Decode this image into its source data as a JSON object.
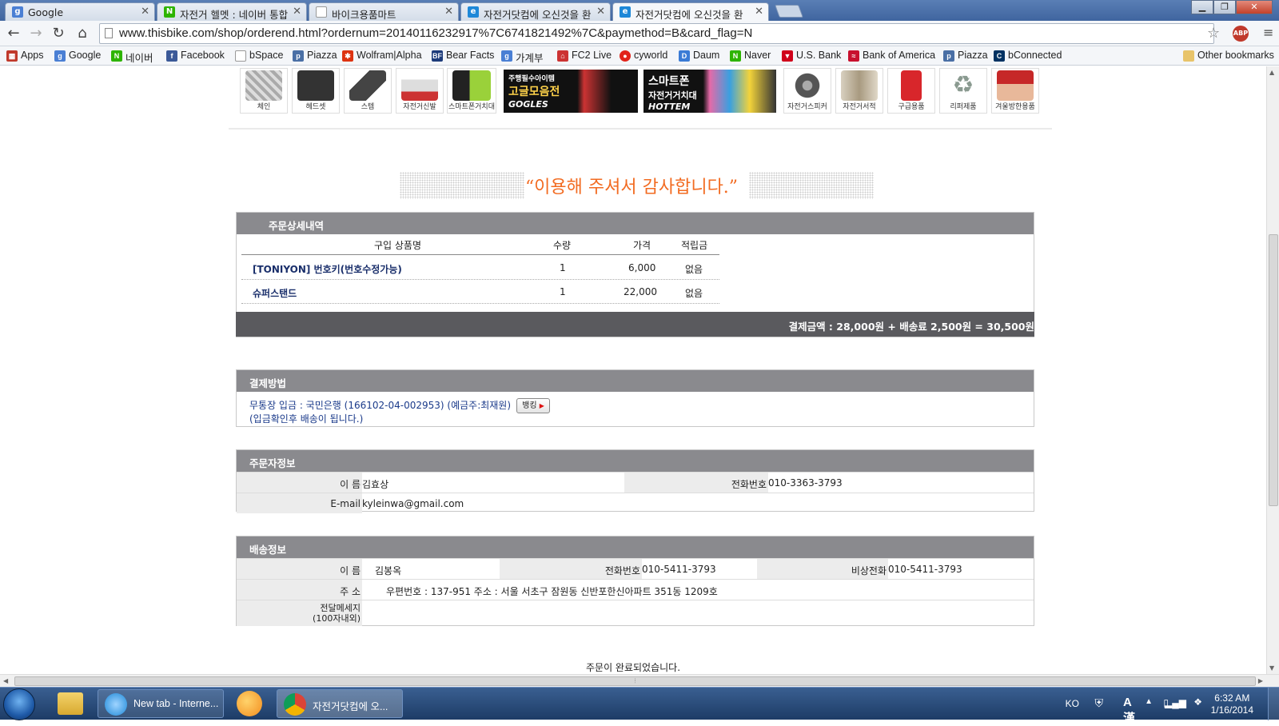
{
  "browser": {
    "tabs": [
      {
        "title": "Google",
        "icon": "google-icon",
        "color": "#4a7fd4"
      },
      {
        "title": "자전거 헬멧 : 네이버 통합",
        "icon": "naver-icon",
        "color": "#2db400"
      },
      {
        "title": "바이크용품마트",
        "icon": "page-icon",
        "color": "#999999"
      },
      {
        "title": "자전거닷컴에 오신것을 환",
        "icon": "ie-icon",
        "color": "#1e88d8"
      },
      {
        "title": "자전거닷컴에 오신것을 환",
        "icon": "ie-icon",
        "color": "#1e88d8"
      }
    ],
    "url": "www.thisbike.com/shop/orderend.html?ordernum=20140116232917%7C6741821492%7C&paymethod=B&card_flag=N",
    "abp_label": "ABP",
    "bookmarks": [
      {
        "label": "Apps",
        "color": "#c0392b"
      },
      {
        "label": "Google",
        "color": "#4a7fd4"
      },
      {
        "label": "네이버",
        "color": "#2db400"
      },
      {
        "label": "Facebook",
        "color": "#3b5998"
      },
      {
        "label": "bSpace",
        "color": "#999999"
      },
      {
        "label": "Piazza",
        "color": "#4a6fa5"
      },
      {
        "label": "Wolfram|Alpha",
        "color": "#dd3311"
      },
      {
        "label": "Bear Facts",
        "color": "#1d3b7a"
      },
      {
        "label": "가계부",
        "color": "#4a7fd4"
      },
      {
        "label": "FC2 Live",
        "color": "#cc3333"
      },
      {
        "label": "cyworld",
        "color": "#e2231a"
      },
      {
        "label": "Daum",
        "color": "#3a7bd5"
      },
      {
        "label": "Naver",
        "color": "#2db400"
      },
      {
        "label": "U.S. Bank",
        "color": "#d0021b"
      },
      {
        "label": "Bank of America",
        "color": "#c8102e"
      },
      {
        "label": "Piazza",
        "color": "#4a6fa5"
      },
      {
        "label": "bConnected",
        "color": "#003262"
      }
    ],
    "other_bookmarks": "Other bookmarks"
  },
  "categories": [
    {
      "label": "체인",
      "color": "#b8b8b8"
    },
    {
      "label": "헤드셋",
      "color": "#333333"
    },
    {
      "label": "스템",
      "color": "#444444"
    },
    {
      "label": "자전거신발",
      "color": "#d9d9d9"
    },
    {
      "label": "스마트폰거치대",
      "color": "#9ad13a"
    },
    {
      "label": "자전거스피커",
      "color": "#555555"
    },
    {
      "label": "자전거서적",
      "color": "#c8c0b0"
    },
    {
      "label": "구급용품",
      "color": "#d8262b"
    },
    {
      "label": "리퍼제품",
      "color": "#9aa5a0"
    },
    {
      "label": "겨울방한용품",
      "color": "#c62828"
    }
  ],
  "banners": [
    {
      "line1": "주행필수아이템",
      "line2": "고글모음전",
      "line3": "GOGLES",
      "color": "#222222"
    },
    {
      "line1": "스마트폰",
      "line2": "자전거거치대",
      "line3": "HOTTEM",
      "color": "#1a1a1a"
    }
  ],
  "thanks": "“이용해 주셔서 감사합니다.”",
  "order": {
    "title": "주문상세내역",
    "headers": [
      "구입 상품명",
      "수량",
      "가격",
      "적립금"
    ],
    "rows": [
      {
        "name": "[TONIYON] 번호키(번호수정가능)",
        "qty": "1",
        "price": "6,000",
        "points": "없음"
      },
      {
        "name": "슈퍼스탠드",
        "qty": "1",
        "price": "22,000",
        "points": "없음"
      }
    ],
    "total": "결제금액 : 28,000원 + 배송료 2,500원 = 30,500원"
  },
  "payment": {
    "title": "결제방법",
    "line1": "무통장 입금 : 국민은행 (166102-04-002953) (예금주:최재원)",
    "line2": "(입금확인후 배송이 됩니다.)",
    "bank_button": "뱅킹"
  },
  "orderer": {
    "title": "주문자정보",
    "name_label": "이 름",
    "name": "김효상",
    "phone_label": "전화번호",
    "phone": "010-3363-3793",
    "email_label": "E-mail",
    "email": "kyleinwa@gmail.com"
  },
  "shipping": {
    "title": "배송정보",
    "name_label": "이 름",
    "name": "김봉옥",
    "phone_label": "전화번호",
    "phone": "010-5411-3793",
    "emergency_label": "비상전화",
    "emergency": "010-5411-3793",
    "address_label": "주 소",
    "address": "우편번호 : 137-951 주소 : 서울 서초구 잠원동 신반포한신아파트 351동 1209호",
    "message_label_1": "전달메세지",
    "message_label_2": "(100자내외)",
    "message": ""
  },
  "complete_text": "주문이 완료되었습니다.",
  "taskbar": {
    "items": [
      {
        "label": "New tab - Interne..."
      },
      {
        "label": "자전거닷컴에 오..."
      }
    ],
    "lang": "KO",
    "ime": "A 漢",
    "time": "6:32 AM",
    "date": "1/16/2014"
  }
}
